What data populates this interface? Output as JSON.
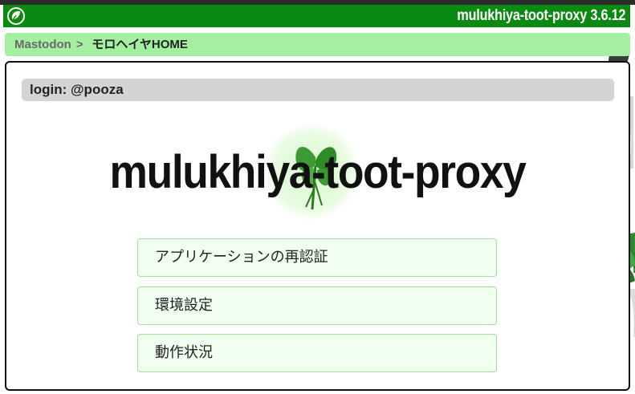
{
  "header": {
    "title": "mulukhiya-toot-proxy 3.6.12",
    "logo_icon": "leaf-logo-icon"
  },
  "breadcrumb": {
    "root": "Mastodon",
    "separator": ">",
    "current": "モロヘイヤHOME"
  },
  "panel": {
    "login_text": "login: @pooza",
    "hero_title": "mulukhiya-toot-proxy",
    "hero_icon": "mulukhiya-leaf-icon",
    "menu": [
      {
        "label": "アプリケーションの再認証"
      },
      {
        "label": "環境設定"
      },
      {
        "label": "動作状況"
      }
    ]
  },
  "colors": {
    "header_bg": "#0a8a10",
    "breadcrumb_bg": "#a4f0a0",
    "login_bg": "#d4d4d4",
    "button_bg": "#f0fff0",
    "button_border": "#9ee29a"
  }
}
